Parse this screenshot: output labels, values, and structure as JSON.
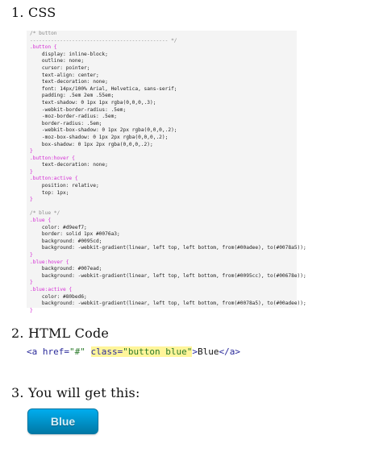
{
  "steps": {
    "css_title": "1. CSS",
    "html_title": "2. HTML Code",
    "result_title": "3. You will get this:"
  },
  "css_code": {
    "lines": [
      {
        "kind": "comment",
        "text": "/* button"
      },
      {
        "kind": "comment",
        "text": "---------------------------------------------- */"
      },
      {
        "kind": "sel",
        "text": ".button {"
      },
      {
        "kind": "text",
        "text": "    display: inline-block;"
      },
      {
        "kind": "text",
        "text": "    outline: none;"
      },
      {
        "kind": "text",
        "text": "    cursor: pointer;"
      },
      {
        "kind": "text",
        "text": "    text-align: center;"
      },
      {
        "kind": "text",
        "text": "    text-decoration: none;"
      },
      {
        "kind": "text",
        "text": "    font: 14px/100% Arial, Helvetica, sans-serif;"
      },
      {
        "kind": "text",
        "text": "    padding: .5em 2em .55em;"
      },
      {
        "kind": "text",
        "text": "    text-shadow: 0 1px 1px rgba(0,0,0,.3);"
      },
      {
        "kind": "text",
        "text": "    -webkit-border-radius: .5em;"
      },
      {
        "kind": "text",
        "text": "    -moz-border-radius: .5em;"
      },
      {
        "kind": "text",
        "text": "    border-radius: .5em;"
      },
      {
        "kind": "text",
        "text": "    -webkit-box-shadow: 0 1px 2px rgba(0,0,0,.2);"
      },
      {
        "kind": "text",
        "text": "    -moz-box-shadow: 0 1px 2px rgba(0,0,0,.2);"
      },
      {
        "kind": "text",
        "text": "    box-shadow: 0 1px 2px rgba(0,0,0,.2);"
      },
      {
        "kind": "sel",
        "text": "}"
      },
      {
        "kind": "sel",
        "text": ".button:hover {"
      },
      {
        "kind": "text",
        "text": "    text-decoration: none;"
      },
      {
        "kind": "sel",
        "text": "}"
      },
      {
        "kind": "sel",
        "text": ".button:active {"
      },
      {
        "kind": "text",
        "text": "    position: relative;"
      },
      {
        "kind": "text",
        "text": "    top: 1px;"
      },
      {
        "kind": "sel",
        "text": "}"
      },
      {
        "kind": "text",
        "text": ""
      },
      {
        "kind": "comment",
        "text": "/* blue */"
      },
      {
        "kind": "sel",
        "text": ".blue {"
      },
      {
        "kind": "text",
        "text": "    color: #d9eef7;"
      },
      {
        "kind": "text",
        "text": "    border: solid 1px #0076a3;"
      },
      {
        "kind": "text",
        "text": "    background: #0095cd;"
      },
      {
        "kind": "text",
        "text": "    background: -webkit-gradient(linear, left top, left bottom, from(#00adee), to(#0078a5));"
      },
      {
        "kind": "sel",
        "text": "}"
      },
      {
        "kind": "sel",
        "text": ".blue:hover {"
      },
      {
        "kind": "text",
        "text": "    background: #007ead;"
      },
      {
        "kind": "text",
        "text": "    background: -webkit-gradient(linear, left top, left bottom, from(#0095cc), to(#00678e));"
      },
      {
        "kind": "sel",
        "text": "}"
      },
      {
        "kind": "sel",
        "text": ".blue:active {"
      },
      {
        "kind": "text",
        "text": "    color: #80bed6;"
      },
      {
        "kind": "text",
        "text": "    background: -webkit-gradient(linear, left top, left bottom, from(#0078a5), to(#00adee));"
      },
      {
        "kind": "sel",
        "text": "}"
      }
    ]
  },
  "html_code": {
    "open_tag": "<a",
    "href_attr": " href=",
    "href_val": "\"#\"",
    "space": " ",
    "class_attr": "class=",
    "class_val": "\"button blue\"",
    "close_open": ">",
    "inner": "Blue",
    "end_tag": "</a>"
  },
  "result": {
    "button_label": "Blue"
  },
  "colors": {
    "comment": "#8a8a8a",
    "selector": "#d42ad4",
    "button_top": "#00adee",
    "button_bottom": "#0078a5",
    "button_text": "#d9eef7",
    "highlight": "#fff59a"
  }
}
